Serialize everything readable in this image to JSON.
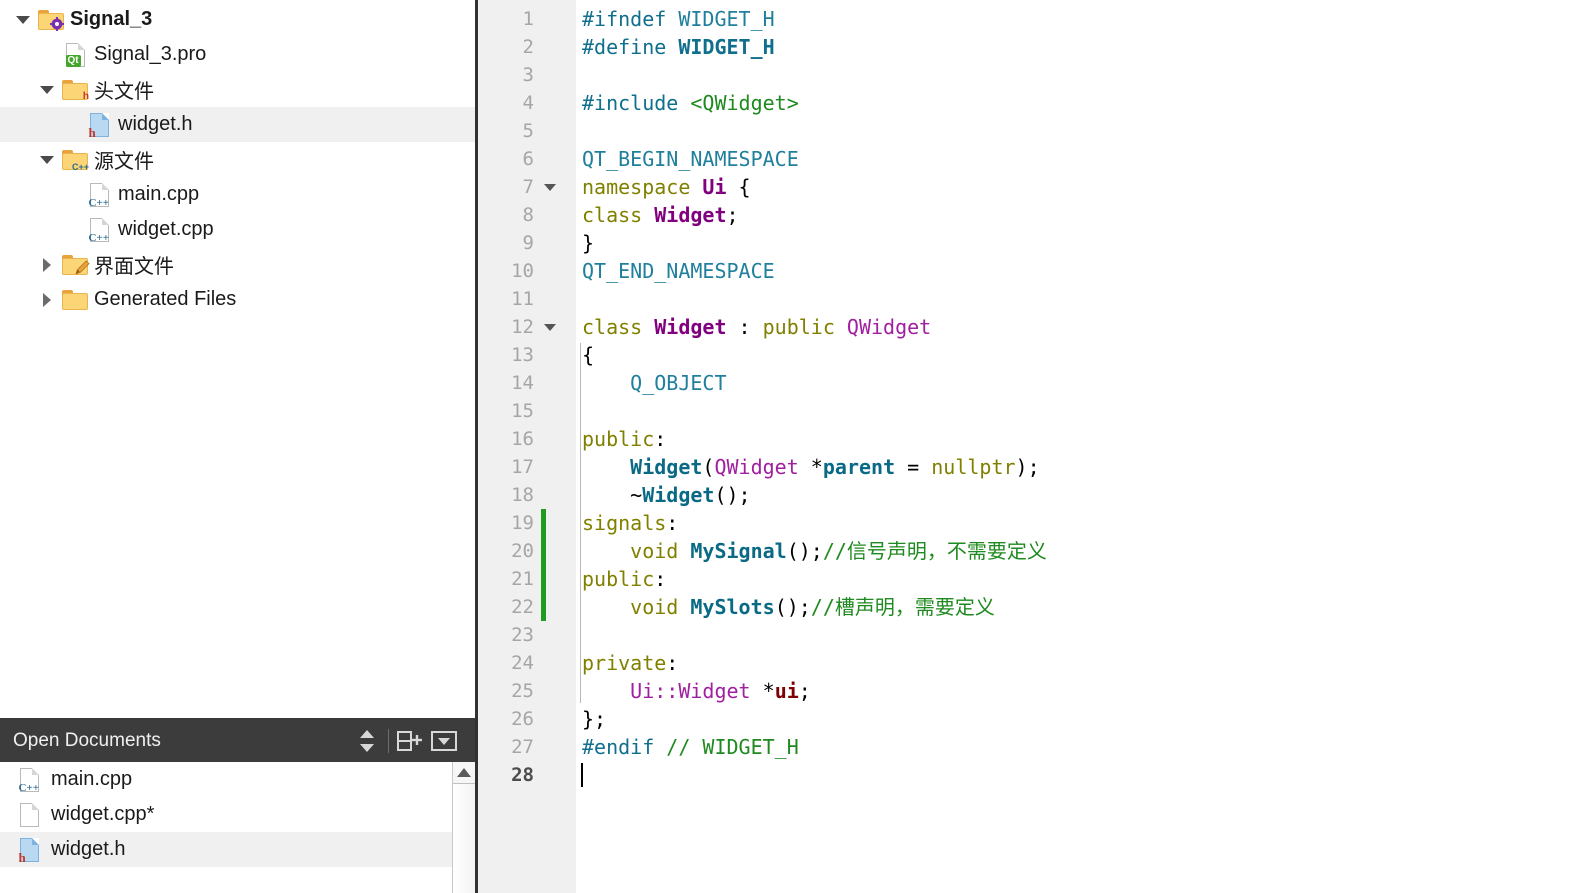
{
  "project_tree": {
    "name": "project-tree",
    "items": [
      {
        "label": "Signal_3",
        "indent": 0,
        "arrow": "down",
        "icon": "folder-gear-icon",
        "bold": true,
        "selected": false
      },
      {
        "label": "Signal_3.pro",
        "indent": 1,
        "arrow": "none",
        "icon": "qt-pro-file-icon",
        "bold": false,
        "selected": false
      },
      {
        "label": "头文件",
        "indent": 1,
        "arrow": "down",
        "icon": "folder-h-icon",
        "bold": false,
        "selected": false
      },
      {
        "label": "widget.h",
        "indent": 2,
        "arrow": "none",
        "icon": "h-file-icon",
        "bold": false,
        "selected": true
      },
      {
        "label": "源文件",
        "indent": 1,
        "arrow": "down",
        "icon": "folder-cpp-icon",
        "bold": false,
        "selected": false
      },
      {
        "label": "main.cpp",
        "indent": 2,
        "arrow": "none",
        "icon": "cpp-file-icon",
        "bold": false,
        "selected": false
      },
      {
        "label": "widget.cpp",
        "indent": 2,
        "arrow": "none",
        "icon": "cpp-file-icon",
        "bold": false,
        "selected": false
      },
      {
        "label": "界面文件",
        "indent": 1,
        "arrow": "right",
        "icon": "folder-ui-icon",
        "bold": false,
        "selected": false
      },
      {
        "label": "Generated Files",
        "indent": 1,
        "arrow": "right",
        "icon": "folder-icon",
        "bold": false,
        "selected": false
      }
    ]
  },
  "open_documents": {
    "title": "Open Documents",
    "buttons": [
      {
        "name": "sort-toggle-button",
        "icon": "sort-updown-icon"
      },
      {
        "name": "split-add-button",
        "icon": "split-window-plus-icon"
      },
      {
        "name": "filter-menu-button",
        "icon": "dropdown-box-icon"
      }
    ],
    "scrollbar": {
      "up_button_icon": "scroll-up-arrow-icon"
    },
    "items": [
      {
        "label": "main.cpp",
        "icon": "cpp-file-icon",
        "modified": false,
        "selected": false
      },
      {
        "label": "widget.cpp*",
        "icon": "blank-file-icon",
        "modified": true,
        "selected": false
      },
      {
        "label": "widget.h",
        "icon": "h-file-icon",
        "modified": false,
        "selected": true
      }
    ]
  },
  "editor": {
    "filename": "widget.h",
    "current_line": 28,
    "total_lines": 28,
    "fold_markers": [
      7,
      12
    ],
    "change_bar_lines": [
      19,
      20,
      21,
      22
    ],
    "change_bar_color": "#1f9b1f",
    "gutter_bg": "#f0f0f0",
    "lines": [
      {
        "n": 1,
        "tokens": [
          {
            "t": "#ifndef ",
            "c": "k-pre"
          },
          {
            "t": "WIDGET_H",
            "c": "k-macro"
          }
        ]
      },
      {
        "n": 2,
        "tokens": [
          {
            "t": "#define ",
            "c": "k-pre"
          },
          {
            "t": "WIDGET_H",
            "c": "k-preb"
          }
        ]
      },
      {
        "n": 3,
        "tokens": []
      },
      {
        "n": 4,
        "tokens": [
          {
            "t": "#include ",
            "c": "k-pre"
          },
          {
            "t": "<QWidget>",
            "c": "k-str"
          }
        ]
      },
      {
        "n": 5,
        "tokens": []
      },
      {
        "n": 6,
        "tokens": [
          {
            "t": "QT_BEGIN_NAMESPACE",
            "c": "k-macro"
          }
        ]
      },
      {
        "n": 7,
        "tokens": [
          {
            "t": "namespace ",
            "c": "k-key"
          },
          {
            "t": "Ui",
            "c": "k-typeb"
          },
          {
            "t": " {",
            "c": "k-txt"
          }
        ]
      },
      {
        "n": 8,
        "tokens": [
          {
            "t": "class ",
            "c": "k-key"
          },
          {
            "t": "Widget",
            "c": "k-typeb"
          },
          {
            "t": ";",
            "c": "k-txt"
          }
        ]
      },
      {
        "n": 9,
        "tokens": [
          {
            "t": "}",
            "c": "k-txt"
          }
        ]
      },
      {
        "n": 10,
        "tokens": [
          {
            "t": "QT_END_NAMESPACE",
            "c": "k-macro"
          }
        ]
      },
      {
        "n": 11,
        "tokens": []
      },
      {
        "n": 12,
        "tokens": [
          {
            "t": "class ",
            "c": "k-key"
          },
          {
            "t": "Widget",
            "c": "k-typeb"
          },
          {
            "t": " : ",
            "c": "k-txt"
          },
          {
            "t": "public ",
            "c": "k-key"
          },
          {
            "t": "QWidget",
            "c": "k-type"
          }
        ]
      },
      {
        "n": 13,
        "tokens": [
          {
            "t": "{",
            "c": "k-txt"
          }
        ]
      },
      {
        "n": 14,
        "tokens": [
          {
            "t": "    ",
            "c": "k-txt"
          },
          {
            "t": "Q_OBJECT",
            "c": "k-macro"
          }
        ]
      },
      {
        "n": 15,
        "tokens": []
      },
      {
        "n": 16,
        "tokens": [
          {
            "t": "public",
            "c": "k-key"
          },
          {
            "t": ":",
            "c": "k-txt"
          }
        ]
      },
      {
        "n": 17,
        "tokens": [
          {
            "t": "    ",
            "c": "k-txt"
          },
          {
            "t": "Widget",
            "c": "k-fn"
          },
          {
            "t": "(",
            "c": "k-txt"
          },
          {
            "t": "QWidget",
            "c": "k-type"
          },
          {
            "t": " *",
            "c": "k-txt"
          },
          {
            "t": "parent",
            "c": "k-parm"
          },
          {
            "t": " = ",
            "c": "k-txt"
          },
          {
            "t": "nullptr",
            "c": "k-key"
          },
          {
            "t": ");",
            "c": "k-txt"
          }
        ]
      },
      {
        "n": 18,
        "tokens": [
          {
            "t": "    ~",
            "c": "k-txt"
          },
          {
            "t": "Widget",
            "c": "k-fn"
          },
          {
            "t": "();",
            "c": "k-txt"
          }
        ]
      },
      {
        "n": 19,
        "tokens": [
          {
            "t": "signals",
            "c": "k-key"
          },
          {
            "t": ":",
            "c": "k-txt"
          }
        ]
      },
      {
        "n": 20,
        "tokens": [
          {
            "t": "    ",
            "c": "k-txt"
          },
          {
            "t": "void ",
            "c": "k-key"
          },
          {
            "t": "MySignal",
            "c": "k-fn"
          },
          {
            "t": "();",
            "c": "k-txt"
          },
          {
            "t": "//信号声明，不需要定义",
            "c": "k-cmt"
          }
        ]
      },
      {
        "n": 21,
        "tokens": [
          {
            "t": "public",
            "c": "k-key"
          },
          {
            "t": ":",
            "c": "k-txt"
          }
        ]
      },
      {
        "n": 22,
        "tokens": [
          {
            "t": "    ",
            "c": "k-txt"
          },
          {
            "t": "void ",
            "c": "k-key"
          },
          {
            "t": "MySlots",
            "c": "k-fn"
          },
          {
            "t": "();",
            "c": "k-txt"
          },
          {
            "t": "//槽声明，需要定义",
            "c": "k-cmt"
          }
        ]
      },
      {
        "n": 23,
        "tokens": []
      },
      {
        "n": 24,
        "tokens": [
          {
            "t": "private",
            "c": "k-key"
          },
          {
            "t": ":",
            "c": "k-txt"
          }
        ]
      },
      {
        "n": 25,
        "tokens": [
          {
            "t": "    ",
            "c": "k-txt"
          },
          {
            "t": "Ui::Widget",
            "c": "k-type"
          },
          {
            "t": " *",
            "c": "k-txt"
          },
          {
            "t": "ui",
            "c": "k-field"
          },
          {
            "t": ";",
            "c": "k-txt"
          }
        ]
      },
      {
        "n": 26,
        "tokens": [
          {
            "t": "};",
            "c": "k-txt"
          }
        ]
      },
      {
        "n": 27,
        "tokens": [
          {
            "t": "#endif ",
            "c": "k-pre"
          },
          {
            "t": "// WIDGET_H",
            "c": "k-cmt"
          }
        ]
      },
      {
        "n": 28,
        "tokens": []
      }
    ]
  },
  "colors": {
    "panel_header_bg": "#3c3c3c",
    "selection_bg": "#f0f0f0",
    "gutter_bg": "#f0f0f0",
    "line_number": "#a6a6a6",
    "current_line_number": "#4d4d4d",
    "comment_green": "#1f8a1f",
    "keyword_olive": "#808000",
    "type_purple": "#a020a0",
    "macro_teal": "#1f7f9c",
    "field_maroon": "#7f0000",
    "change_bar": "#1f9b1f"
  }
}
